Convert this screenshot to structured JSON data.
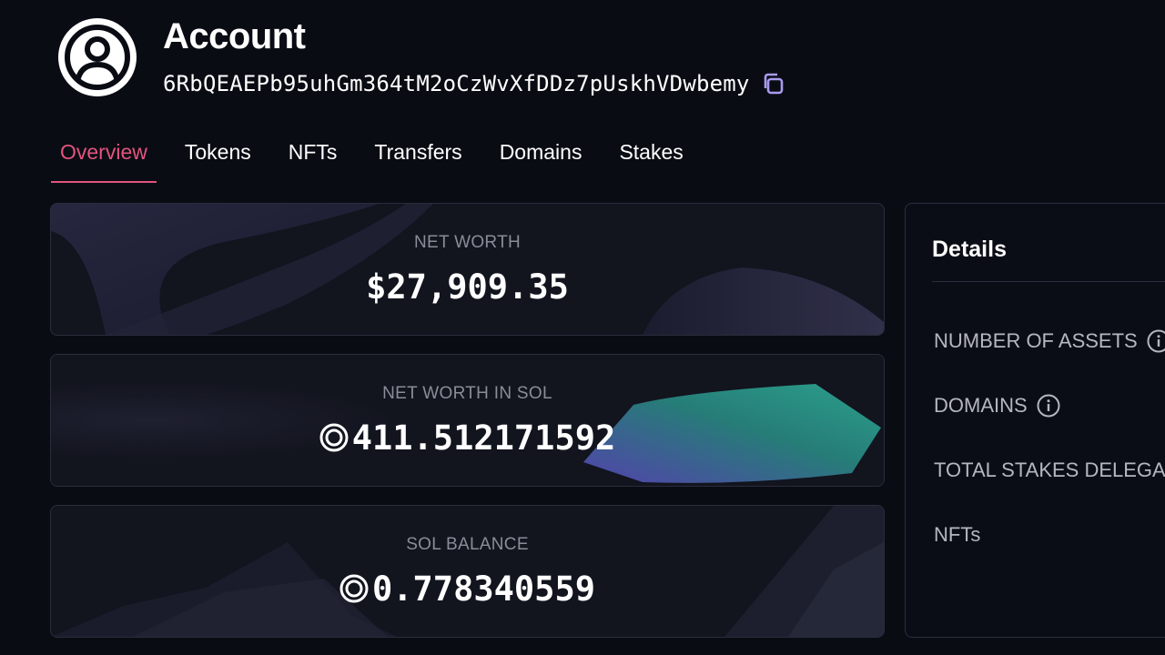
{
  "header": {
    "title": "Account",
    "address": "6RbQEAEPb95uhGm364tM2oCzWvXfDDz7pUskhVDwbemy"
  },
  "tabs": [
    {
      "label": "Overview",
      "active": true
    },
    {
      "label": "Tokens",
      "active": false
    },
    {
      "label": "NFTs",
      "active": false
    },
    {
      "label": "Transfers",
      "active": false
    },
    {
      "label": "Domains",
      "active": false
    },
    {
      "label": "Stakes",
      "active": false
    }
  ],
  "cards": {
    "net_worth": {
      "label": "NET WORTH",
      "value": "$27,909.35"
    },
    "net_worth_sol": {
      "label": "NET WORTH IN SOL",
      "value": "411.512171592"
    },
    "sol_balance": {
      "label": "SOL BALANCE",
      "value": "0.778340559"
    }
  },
  "details": {
    "title": "Details",
    "rows": [
      "NUMBER OF ASSETS",
      "DOMAINS",
      "TOTAL STAKES DELEGA",
      "NFTs"
    ]
  },
  "colors": {
    "accent": "#e2547d",
    "copy_icon": "#a89bf0",
    "background": "#0a0c14"
  },
  "icons": [
    "user-circle-icon",
    "copy-icon",
    "sol-icon",
    "info-icon"
  ]
}
